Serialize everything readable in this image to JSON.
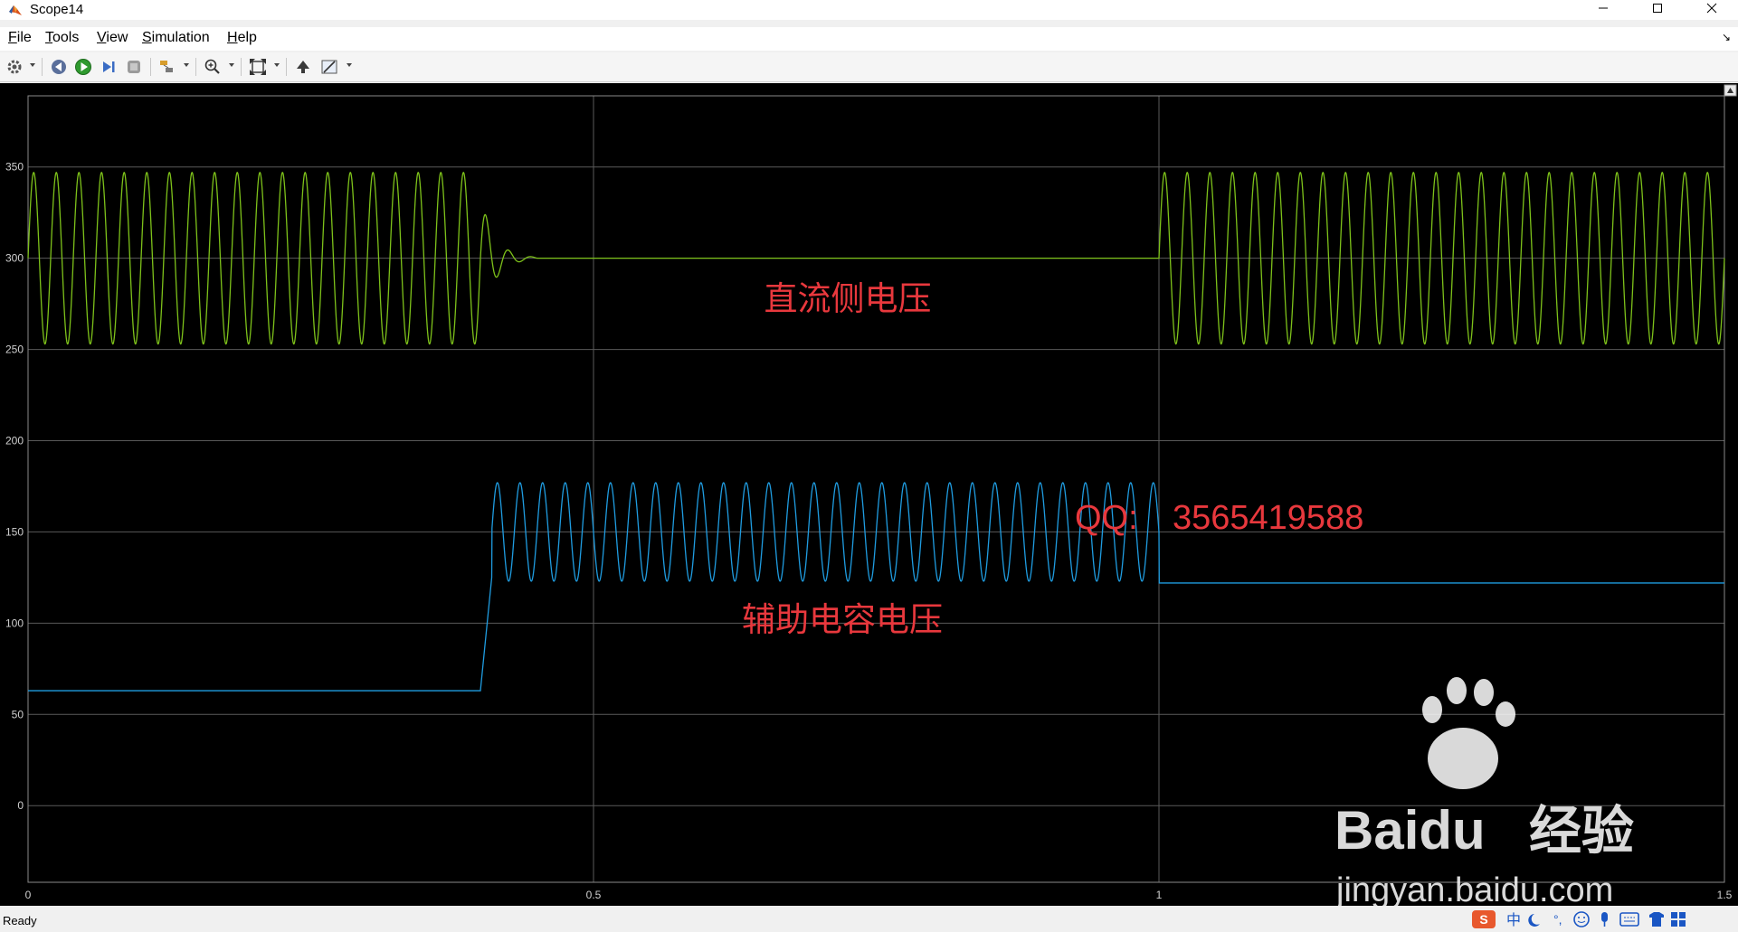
{
  "window": {
    "title": "Scope14"
  },
  "menu": [
    {
      "label": "File",
      "key": "F",
      "rest": "ile"
    },
    {
      "label": "Tools",
      "key": "T",
      "rest": "ools"
    },
    {
      "label": "View",
      "key": "V",
      "rest": "iew"
    },
    {
      "label": "Simulation",
      "key": "S",
      "rest": "imulation"
    },
    {
      "label": "Help",
      "key": "H",
      "rest": "elp"
    }
  ],
  "toolbar": {
    "buttons": [
      "settings-icon",
      "step-back-icon",
      "run-icon",
      "step-forward-icon",
      "stop-icon",
      "highlight-block-icon",
      "zoom-in-icon",
      "autoscale-icon",
      "write-data-icon",
      "measurements-icon"
    ]
  },
  "status": {
    "text": "Ready"
  },
  "annotations": {
    "dc_label": "直流侧电压",
    "aux_label": "辅助电容电压",
    "qq_label": "QQ:",
    "qq_number": "3565419588"
  },
  "watermark": {
    "brand": "Baidu",
    "cn": "经验",
    "url": "jingyan.baidu.com"
  },
  "ime": {
    "glyph": "中"
  },
  "colors": {
    "green_series": "#7dc11a",
    "blue_series": "#1f9ce0",
    "grid": "#5a5a5a",
    "annotation": "#e8383d",
    "background": "#000000"
  },
  "chart_data": {
    "type": "line",
    "xlim": [
      0,
      1.5
    ],
    "ylim": [
      -42,
      389
    ],
    "x_ticks": [
      "0",
      "0.5",
      "1",
      "1.5"
    ],
    "y_ticks": [
      "0",
      "50",
      "100",
      "150",
      "200",
      "250",
      "300",
      "350"
    ],
    "grid": true,
    "series": [
      {
        "name": "",
        "color": "#7dc11a",
        "segments": [
          {
            "x_range": [
              0,
              0.4
            ],
            "shape": "oscillation",
            "center": 300,
            "amplitude": 47,
            "frequency_hz": 50
          },
          {
            "x_range": [
              0.4,
              0.45
            ],
            "shape": "damped_oscillation",
            "center": 300,
            "amplitude": 35
          },
          {
            "x_range": [
              0.45,
              1.0
            ],
            "shape": "flat",
            "value": 300
          },
          {
            "x_range": [
              1.0,
              1.5
            ],
            "shape": "oscillation",
            "center": 300,
            "amplitude": 47,
            "frequency_hz": 50
          }
        ]
      },
      {
        "name": "",
        "color": "#1f9ce0",
        "segments": [
          {
            "x_range": [
              0,
              0.4
            ],
            "shape": "flat",
            "value": 63
          },
          {
            "x_range": [
              0.4,
              0.41
            ],
            "shape": "ramp",
            "from": 63,
            "to": 125
          },
          {
            "x_range": [
              0.41,
              1.0
            ],
            "shape": "oscillation",
            "center": 150,
            "amplitude": 27,
            "frequency_hz": 50
          },
          {
            "x_range": [
              1.0,
              1.5
            ],
            "shape": "flat",
            "value": 122
          }
        ]
      }
    ]
  }
}
